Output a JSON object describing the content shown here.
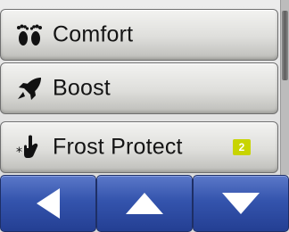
{
  "menu": {
    "items": [
      {
        "label": "Comfort",
        "icon": "footprints-icon"
      },
      {
        "label": "Boost",
        "icon": "rocket-icon"
      },
      {
        "label": "Frost Protect",
        "icon": "snowflake-hand-icon",
        "badge": "2"
      }
    ]
  },
  "nav": {
    "buttons": [
      {
        "icon": "arrow-left-icon"
      },
      {
        "icon": "arrow-up-icon"
      },
      {
        "icon": "arrow-down-icon"
      }
    ]
  },
  "colors": {
    "nav_button": "#3454ad",
    "badge": "#c8d400",
    "text": "#141414"
  }
}
